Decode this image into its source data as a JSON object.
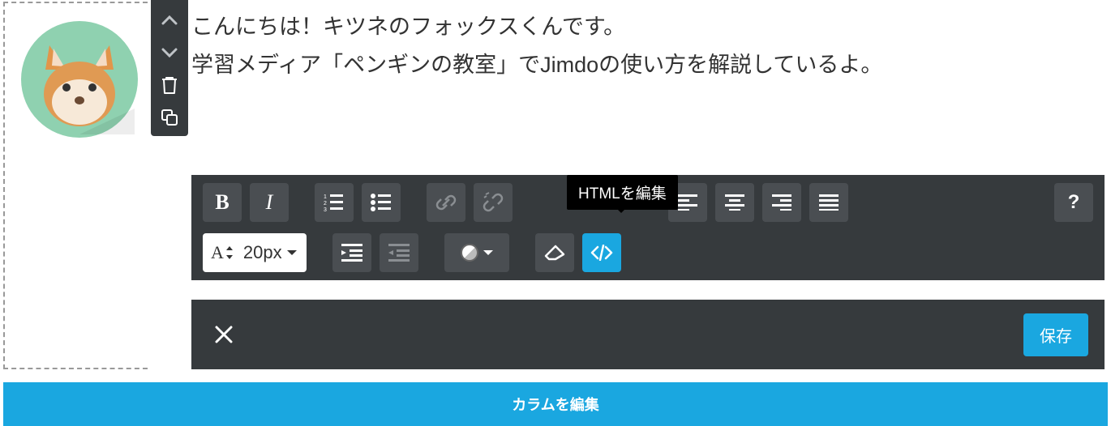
{
  "content": {
    "text": "こんにちは！キツネのフォックスくんです。\n学習メディア「ペンギンの教室」でJimdoの使い方を解説しているよ。"
  },
  "tooltip": {
    "html_edit": "HTMLを編集"
  },
  "font": {
    "size_label": "20px"
  },
  "actions": {
    "save": "保存"
  },
  "footer": {
    "column_edit": "カラムを編集"
  },
  "icons": {
    "move_up": "move-up",
    "move_down": "move-down",
    "trash": "trash",
    "duplicate": "duplicate",
    "bold": "bold",
    "italic": "italic",
    "ordered_list": "ordered-list",
    "unordered_list": "unordered-list",
    "link": "link",
    "unlink": "unlink",
    "align_left": "align-left",
    "align_center": "align-center",
    "align_right": "align-right",
    "align_justify": "align-justify",
    "help": "help",
    "font_size": "font-size",
    "indent": "indent",
    "outdent": "outdent",
    "color": "color",
    "clear_format": "clear-format",
    "html": "html",
    "close": "close"
  },
  "colors": {
    "accent": "#1aa7e0",
    "toolbar_bg": "#363a3d",
    "button_bg": "#4a4e52"
  }
}
